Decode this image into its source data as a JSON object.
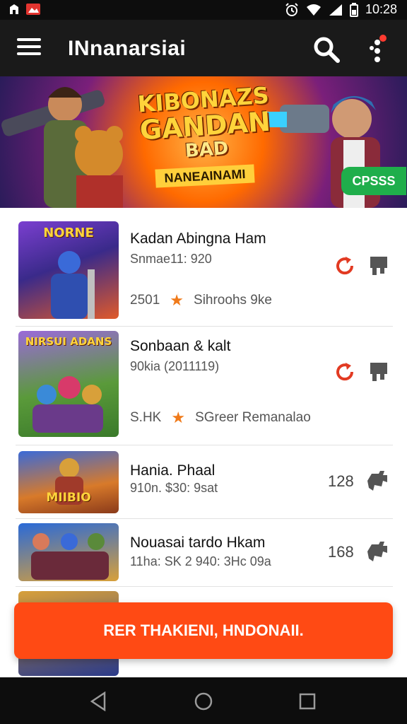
{
  "status_bar": {
    "time": "10:28"
  },
  "app_bar": {
    "title": "INnanarsiai"
  },
  "banner": {
    "title_lines": [
      "KIBONAZS",
      "GANDAN",
      "BAD"
    ],
    "subtitle": "NANEAINAMI",
    "badge": "CPSSS"
  },
  "items": [
    {
      "name": "Kadan Abingna Ham",
      "meta": "Snmae11: 920",
      "rating": "2501",
      "extra": "Sihroohs 9ke",
      "thumb_text": "NORNE"
    },
    {
      "name": "Sonbaan & kalt",
      "meta": "90kia (2011119)",
      "rating": "S.HK",
      "extra": "SGreer Remanalao",
      "thumb_text": "NIRSUI ADANS"
    },
    {
      "name": "Hania. Phaal",
      "meta": "910n. $30: 9sat",
      "count": "128",
      "thumb_text": "MIIBIO"
    },
    {
      "name": "Nouasai tardo Hkam",
      "meta": "11ha: SK 2 940: 3Hc 09a",
      "count": "168",
      "thumb_text": ""
    }
  ],
  "cta": {
    "label": "RER THAKIENI, HNDONAII."
  },
  "colors": {
    "accent": "#ff4a14",
    "star": "#f07a1a",
    "badge": "#1fae4b",
    "app_bar": "#1a1a1a"
  }
}
